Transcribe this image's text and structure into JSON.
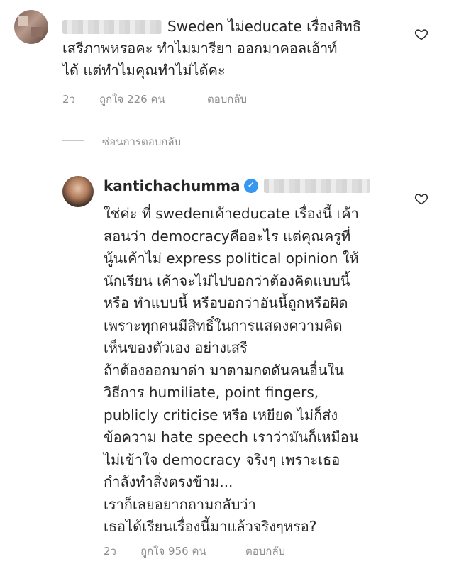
{
  "comment1": {
    "lines": [
      "Sweden ไม่educate เรื่องสิทธิ",
      "เสรีภาพหรอคะ ทำไมมารียา ออกมาคอลเอ้าท์",
      "ได้ แต่ทำไมคุณทำไม่ได้คะ"
    ],
    "time": "2ว",
    "likes": "ถูกใจ 226 คน",
    "reply_label": "ตอบกลับ"
  },
  "hide_replies": "ซ่อนการตอบกลับ",
  "reply": {
    "username": "kantichachumma",
    "lines": [
      "ใช่ค่ะ ที่ swedenเค้าeducate เรื่องนี้ เค้า",
      "สอนว่า democracyคืออะไร แต่คุณครูที่",
      "นู้นเค้าไม่ express political opinion ให้",
      "นักเรียน เค้าจะไม่ไปบอกว่าต้องคิดแบบนี้",
      "หรือ ทำแบบนี้ หรือบอกว่าอันนี้ถูกหรือผิด",
      "เพราะทุกคนมีสิทธิ์ในการแสดงความคิด",
      "เห็นของตัวเอง อย่างเสรี",
      "ถ้าต้องออกมาด่า มาตามกดดันคนอื่นใน",
      "วิธีการ humiliate, point fingers,",
      "publicly criticise หรือ เหยียด ไม่ก็ส่ง",
      "ข้อความ hate speech เราว่ามันก็เหมือน",
      "ไม่เข้าใจ democracy จริงๆ เพราะเธอ",
      "กำลังทำสิ่งตรงข้าม...",
      "เราก็เลยอยากถามกลับว่า",
      "เธอได้เรียนเรื่องนี้มาแล้วจริงๆหรอ?"
    ],
    "time": "2ว",
    "likes": "ถูกใจ 956 คน",
    "reply_label": "ตอบกลับ"
  },
  "icons": {
    "like": "heart-icon",
    "verified": "verified-badge-icon"
  }
}
